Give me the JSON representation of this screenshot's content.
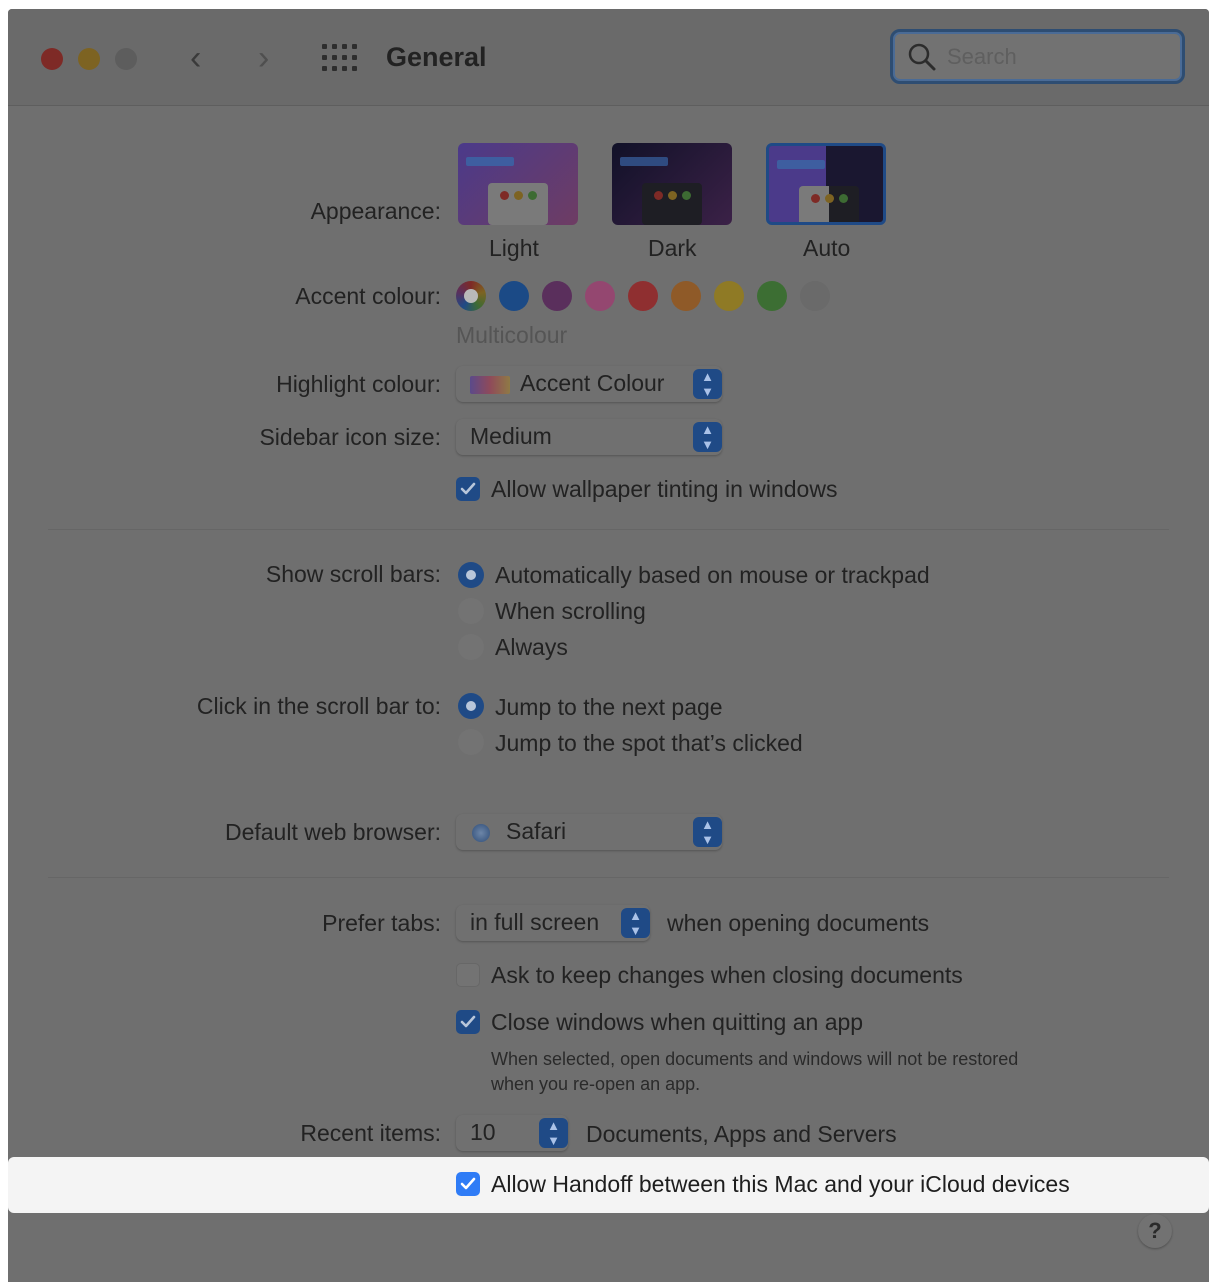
{
  "window": {
    "title": "General",
    "search_placeholder": "Search",
    "nav_back": "‹",
    "nav_forward": "›"
  },
  "appearance": {
    "label": "Appearance:",
    "options": [
      {
        "label": "Light",
        "selected": false
      },
      {
        "label": "Dark",
        "selected": false
      },
      {
        "label": "Auto",
        "selected": true
      }
    ]
  },
  "accent": {
    "label": "Accent colour:",
    "selected_name": "Multicolour",
    "colors": [
      "#5c5ea8",
      "#1b4a86",
      "#5a2f5c",
      "#944770",
      "#8f2f30",
      "#8f5a28",
      "#8f7a25",
      "#3c6e33",
      "#6a6a6a"
    ]
  },
  "highlight_colour": {
    "label": "Highlight colour:",
    "value": "Accent Colour"
  },
  "sidebar_icon_size": {
    "label": "Sidebar icon size:",
    "value": "Medium"
  },
  "wallpaper_tinting": {
    "label": "Allow wallpaper tinting in windows",
    "checked": true
  },
  "scroll_bars": {
    "label": "Show scroll bars:",
    "options": [
      {
        "label": "Automatically based on mouse or trackpad",
        "selected": true
      },
      {
        "label": "When scrolling",
        "selected": false
      },
      {
        "label": "Always",
        "selected": false
      }
    ]
  },
  "click_scroll_bar": {
    "label": "Click in the scroll bar to:",
    "options": [
      {
        "label": "Jump to the next page",
        "selected": true
      },
      {
        "label": "Jump to the spot that’s clicked",
        "selected": false
      }
    ]
  },
  "default_browser": {
    "label": "Default web browser:",
    "value": "Safari"
  },
  "prefer_tabs": {
    "label": "Prefer tabs:",
    "value": "in full screen",
    "suffix": "when opening documents"
  },
  "ask_keep_changes": {
    "label": "Ask to keep changes when closing documents",
    "checked": false
  },
  "close_windows": {
    "label": "Close windows when quitting an app",
    "checked": true,
    "note_line1": "When selected, open documents and windows will not be restored",
    "note_line2": "when you re-open an app."
  },
  "recent_items": {
    "label": "Recent items:",
    "value": "10",
    "suffix": "Documents, Apps and Servers"
  },
  "handoff": {
    "label": "Allow Handoff between this Mac and your iCloud devices",
    "checked": true
  },
  "help": {
    "label": "?"
  }
}
